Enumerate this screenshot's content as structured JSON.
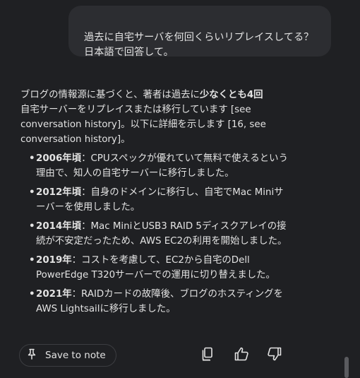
{
  "user_message": {
    "text": "過去に自宅サーバを何回くらいリプレイスしてる？\n日本語で回答して。"
  },
  "response": {
    "intro_before": "ブログの情報源に基づくと、著者は過去に",
    "intro_bold": "少なくとも4回",
    "intro_after": "自宅サーバーをリプレイスまたは移行しています [see conversation history]。以下に詳細を示します [16, see conversation history]。",
    "items": [
      {
        "label": "2006年頃",
        "text": "：CPUスペックが優れていて無料で使えるという理由で、知人の自宅サーバーに移行しました。"
      },
      {
        "label": "2012年頃",
        "text": "：自身のドメインに移行し、自宅でMac Miniサーバーを使用しました。"
      },
      {
        "label": "2014年頃",
        "text": "：Mac MiniとUSB3 RAID 5ディスクアレイの接続が不安定だったため、AWS EC2の利用を開始しました。"
      },
      {
        "label": "2019年",
        "text": "：コストを考慮して、EC2から自宅のDell PowerEdge T320サーバーでの運用に切り替えました。"
      },
      {
        "label": "2021年",
        "text": "：RAIDカードの故障後、ブログのホスティングをAWS Lightsailに移行しました。"
      }
    ]
  },
  "actions": {
    "save_to_note": "Save to note",
    "icons": [
      "pin-icon",
      "copy-icon",
      "thumbs-up-icon",
      "thumbs-down-icon"
    ]
  },
  "colors": {
    "background": "#1f2023",
    "bubble": "#2c2d31",
    "text": "#e3e3e3"
  }
}
